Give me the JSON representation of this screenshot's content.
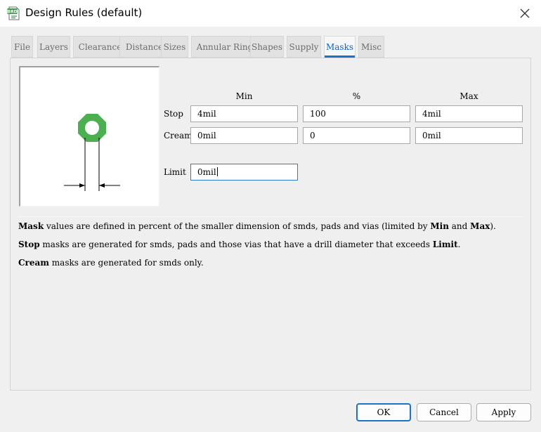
{
  "window": {
    "title": "Design Rules (default)",
    "icon_label": "BRD"
  },
  "tabs": [
    {
      "label": "File"
    },
    {
      "label": "Layers"
    },
    {
      "label": "Clearance"
    },
    {
      "label": "Distance"
    },
    {
      "label": "Sizes"
    },
    {
      "label": "Annular Ring"
    },
    {
      "label": "Shapes"
    },
    {
      "label": "Supply"
    },
    {
      "label": "Masks"
    },
    {
      "label": "Misc"
    }
  ],
  "active_tab": "Masks",
  "masks": {
    "columns": {
      "min": "Min",
      "percent": "%",
      "max": "Max"
    },
    "stop": {
      "label": "Stop",
      "min": "4mil",
      "percent": "100",
      "max": "4mil"
    },
    "cream": {
      "label": "Cream",
      "min": "0mil",
      "percent": "0",
      "max": "0mil"
    },
    "limit": {
      "label": "Limit",
      "value": "0mil"
    }
  },
  "description": {
    "line1": {
      "mask": "Mask",
      "text_a": " values are defined in percent of the smaller dimension of smds, pads and vias (limited by ",
      "min": "Min",
      "text_b": " and ",
      "max": "Max",
      "text_c": ")."
    },
    "line2": {
      "stop": "Stop",
      "text_a": " masks are generated for smds, pads and those vias that have a drill diameter that exceeds ",
      "limit": "Limit",
      "text_b": "."
    },
    "line3": {
      "cream": "Cream",
      "text_a": " masks are generated for smds only."
    }
  },
  "buttons": {
    "ok": "OK",
    "cancel": "Cancel",
    "apply": "Apply"
  },
  "colors": {
    "accent": "#1a73c8",
    "pad_green": "#4caf50",
    "active_tab_text": "#0a64c8"
  }
}
